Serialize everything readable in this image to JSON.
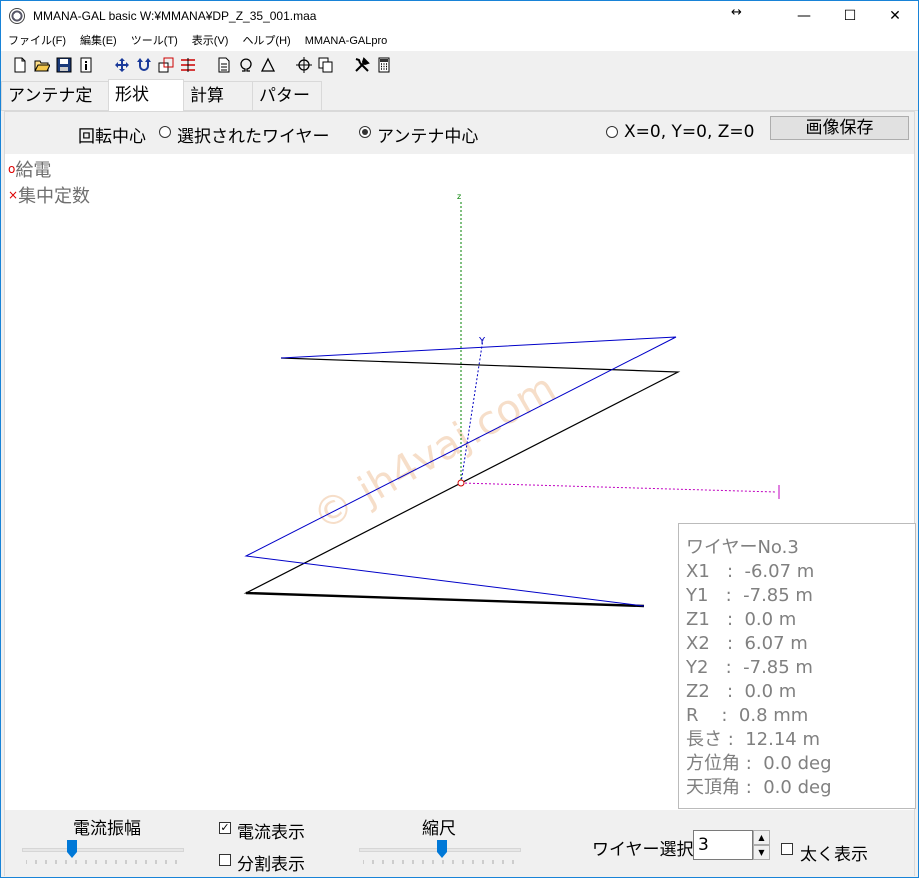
{
  "window": {
    "title": "MMANA-GAL basic  W:¥MMANA¥DP_Z_35_001.maa",
    "resize_glyph": "↔",
    "minimize": "—",
    "maximize": "☐",
    "close": "✕"
  },
  "menu": [
    "ファイル(F)",
    "編集(E)",
    "ツール(T)",
    "表示(V)",
    "ヘルプ(H)",
    "MMANA-GALpro"
  ],
  "toolbar": {
    "icons": [
      "new-file-icon",
      "open-folder-icon",
      "save-disk-icon",
      "info-icon",
      "move-arrows-icon",
      "rotate-icon",
      "zoom-box-icon",
      "wire-list-icon",
      "document-icon",
      "ohm-icon",
      "triangle-icon",
      "crosshair-icon",
      "copy-icon",
      "tools-icon",
      "calculator-icon"
    ]
  },
  "tabs": [
    {
      "label": "アンテナ定義",
      "active": false
    },
    {
      "label": "形状",
      "active": true
    },
    {
      "label": "計算",
      "active": false
    },
    {
      "label": "パターン",
      "active": false
    }
  ],
  "rotation": {
    "label": "回転中心",
    "options": [
      {
        "label": "選択されたワイヤー",
        "checked": false
      },
      {
        "label": "アンテナ中心",
        "checked": true
      },
      {
        "label": "X=0, Y=0, Z=0",
        "checked": false
      }
    ],
    "save_button": "画像保存"
  },
  "legend": {
    "feed_marker": "o",
    "feed": "給電",
    "lumped_marker": "×",
    "lumped": "集中定数"
  },
  "axes": {
    "z": "z",
    "y": "Y"
  },
  "watermark": "© jh4vaj.com",
  "wire_info": {
    "title": "ワイヤーNo.3",
    "lines": [
      "X1   :  -6.07 m",
      "Y1   :  -7.85 m",
      "Z1   :  0.0 m",
      "X2   :  6.07 m",
      "Y2   :  -7.85 m",
      "Z2   :  0.0 m",
      "R    :  0.8 mm",
      "長さ :  12.14 m",
      "方位角 :  0.0 deg",
      "天頂角 :  0.0 deg"
    ]
  },
  "bottom": {
    "current_amplitude_label": "電流振幅",
    "show_current_label": "電流表示",
    "show_current": true,
    "split_display_label": "分割表示",
    "split_display": false,
    "scale_label": "縮尺",
    "wire_select_label": "ワイヤー選択",
    "wire_select_value": "3",
    "bold_display_label": "太く表示",
    "bold_display": false,
    "check_mark": "✓",
    "spin_up": "▲",
    "spin_down": "▼"
  },
  "colors": {
    "accent": "#1883d7",
    "z_axis": "#008000",
    "y_axis": "#0000c0",
    "x_axis": "#c000c0",
    "current_line": "#0000c8",
    "wire_line": "#000000",
    "feed_marker": "#d00000",
    "slider_thumb": "#0078d7"
  }
}
